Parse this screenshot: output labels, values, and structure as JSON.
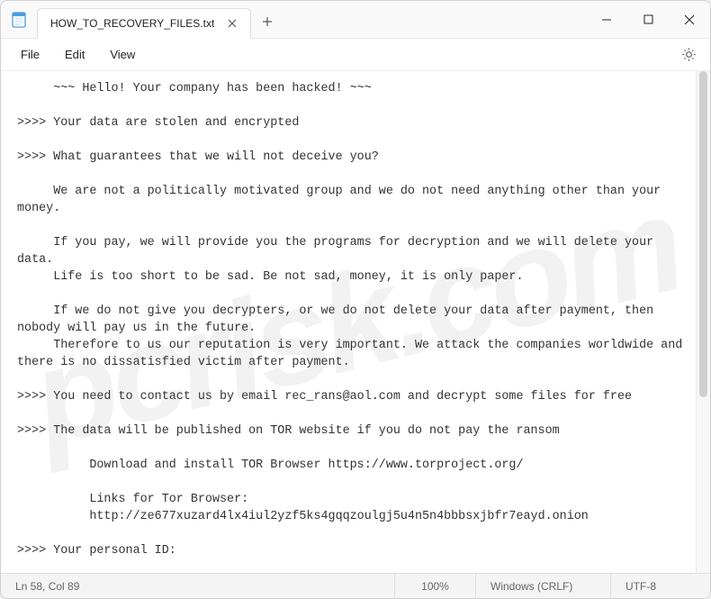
{
  "titlebar": {
    "tab_title": "HOW_TO_RECOVERY_FILES.txt"
  },
  "menubar": {
    "file": "File",
    "edit": "Edit",
    "view": "View"
  },
  "content": {
    "text": "     ~~~ Hello! Your company has been hacked! ~~~\n\n>>>> Your data are stolen and encrypted\n\n>>>> What guarantees that we will not deceive you?\n\n     We are not a politically motivated group and we do not need anything other than your money.\n\n     If you pay, we will provide you the programs for decryption and we will delete your data.\n     Life is too short to be sad. Be not sad, money, it is only paper.\n\n     If we do not give you decrypters, or we do not delete your data after payment, then nobody will pay us in the future.\n     Therefore to us our reputation is very important. We attack the companies worldwide and there is no dissatisfied victim after payment.\n\n>>>> You need to contact us by email rec_rans@aol.com and decrypt some files for free\n\n>>>> The data will be published on TOR website if you do not pay the ransom\n\n          Download and install TOR Browser https://www.torproject.org/\n\n          Links for Tor Browser:\n          http://ze677xuzard4lx4iul2yzf5ks4gqqzoulgj5u4n5n4bbbsxjbfr7eayd.onion\n\n>>>> Your personal ID:"
  },
  "statusbar": {
    "position": "Ln 58, Col 89",
    "zoom": "100%",
    "line_endings": "Windows (CRLF)",
    "encoding": "UTF-8"
  },
  "watermark": "pcrisk.com"
}
